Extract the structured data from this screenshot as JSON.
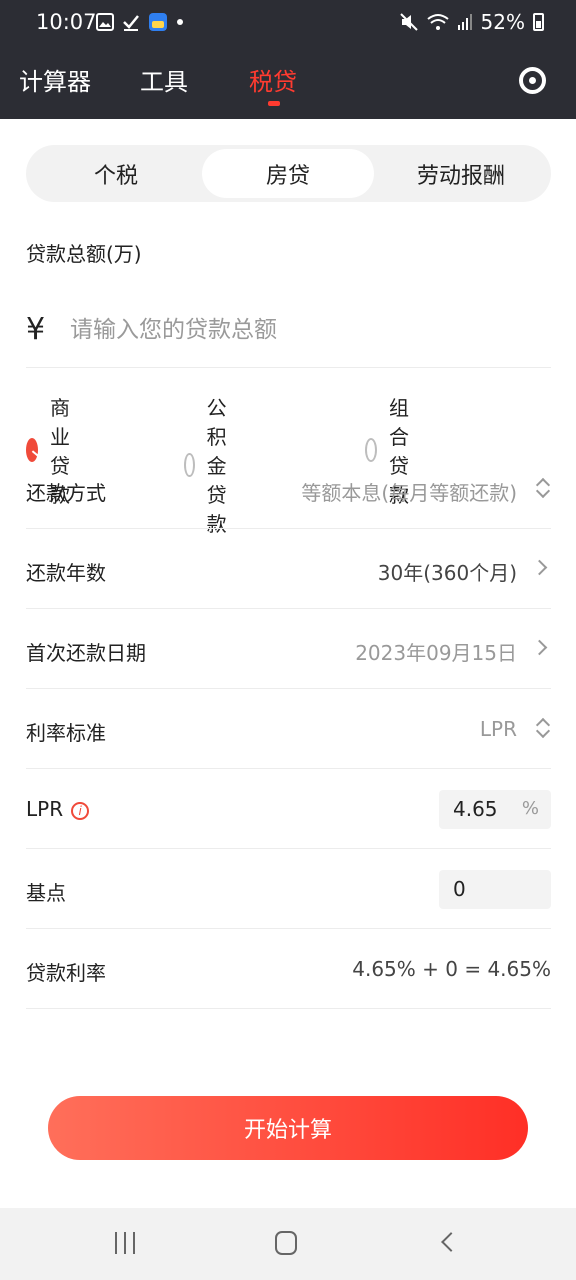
{
  "status_bar": {
    "time": "10:07",
    "battery": "52%",
    "icons": [
      "gallery-icon",
      "checkmark-icon",
      "app-icon",
      "dot-icon",
      "mute-icon",
      "wifi-icon",
      "signal-icon",
      "battery-icon"
    ]
  },
  "top_nav": {
    "tabs": [
      {
        "label": "计算器",
        "active": false
      },
      {
        "label": "工具",
        "active": false
      },
      {
        "label": "税贷",
        "active": true
      }
    ],
    "settings_icon": "settings-icon"
  },
  "segment": {
    "items": [
      {
        "label": "个税",
        "active": false
      },
      {
        "label": "房贷",
        "active": true
      },
      {
        "label": "劳动报酬",
        "active": false
      }
    ]
  },
  "loan_amount": {
    "label": "贷款总额(万)",
    "currency_symbol": "¥",
    "placeholder": "请输入您的贷款总额",
    "value": ""
  },
  "loan_types": [
    {
      "label": "商业贷款",
      "checked": true
    },
    {
      "label": "公积金贷款",
      "checked": false
    },
    {
      "label": "组合贷款",
      "checked": false
    }
  ],
  "settings": {
    "repay_method": {
      "label": "还款方式",
      "value": "等额本息(每月等额还款)"
    },
    "repay_years": {
      "label": "还款年数",
      "value": "30年(360个月)"
    },
    "first_repay_date": {
      "label": "首次还款日期",
      "value": "2023年09月15日"
    },
    "rate_standard": {
      "label": "利率标准",
      "value": "LPR"
    },
    "lpr": {
      "label": "LPR",
      "value": "4.65",
      "unit": "%"
    },
    "basis_points": {
      "label": "基点",
      "value": "0"
    },
    "loan_rate": {
      "label": "贷款利率",
      "value": "4.65% + 0 = 4.65%"
    }
  },
  "calc_button": {
    "label": "开始计算"
  },
  "colors": {
    "accent": "#f04a3a",
    "header_bg": "#2c2d34"
  }
}
